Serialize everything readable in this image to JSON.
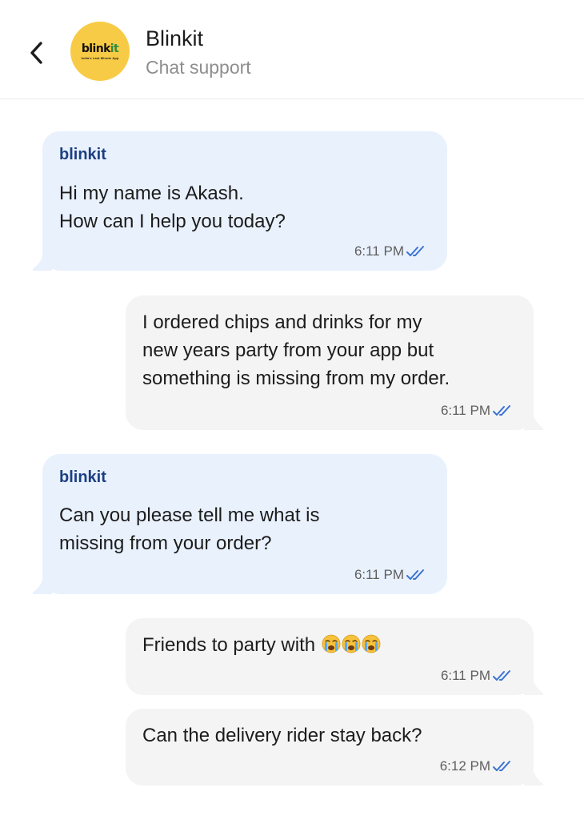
{
  "header": {
    "title": "Blinkit",
    "subtitle": "Chat support",
    "logo_word_main": "blink",
    "logo_word_accent": "it",
    "logo_tagline": "India's Last Minute App",
    "back_icon": "chevron-left-icon"
  },
  "colors": {
    "incoming_bubble": "#e9f1fd",
    "outgoing_bubble": "#f4f4f4",
    "sender_name": "#1d3f82",
    "read_ticks": "#3a73d4",
    "logo_bg": "#f8cb46"
  },
  "messages": [
    {
      "direction": "incoming",
      "sender": "blinkit",
      "lines": [
        "Hi my name is Akash.",
        "How can I help you today?"
      ],
      "time": "6:11 PM",
      "status": "read"
    },
    {
      "direction": "outgoing",
      "lines": [
        "I ordered chips and drinks for my",
        "new years party from your app but",
        "something is missing from my order."
      ],
      "time": "6:11 PM",
      "status": "read"
    },
    {
      "direction": "incoming",
      "sender": "blinkit",
      "lines": [
        "Can you please tell me what is",
        "missing from your order?"
      ],
      "time": "6:11 PM",
      "status": "read"
    },
    {
      "direction": "outgoing",
      "lines": [
        "Friends to party with"
      ],
      "emoji": [
        "crying-face-icon",
        "crying-face-icon",
        "crying-face-icon"
      ],
      "time": "6:11 PM",
      "status": "read"
    },
    {
      "direction": "outgoing",
      "lines": [
        "Can the delivery rider stay back?"
      ],
      "time": "6:12 PM",
      "status": "read"
    }
  ]
}
